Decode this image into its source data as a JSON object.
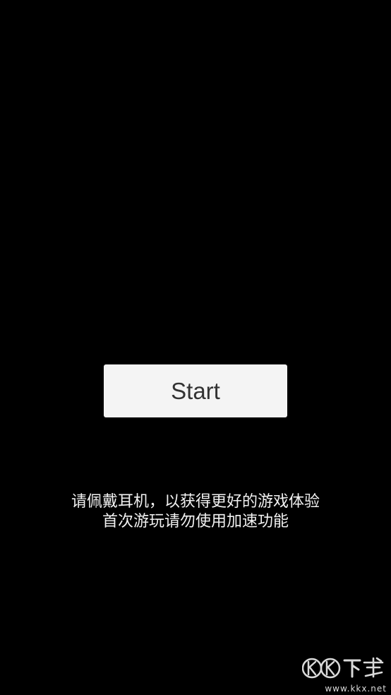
{
  "start_button": {
    "label": "Start"
  },
  "notice": {
    "line1": "请佩戴耳机，以获得更好的游戏体验",
    "line2": "首次游玩请勿使用加速功能"
  },
  "watermark": {
    "logo_text": "KK下载",
    "url": "www.kkx.net"
  },
  "colors": {
    "background": "#000000",
    "button_bg": "#f4f4f4",
    "button_text": "#333333",
    "notice_text": "#f2f2f2"
  }
}
